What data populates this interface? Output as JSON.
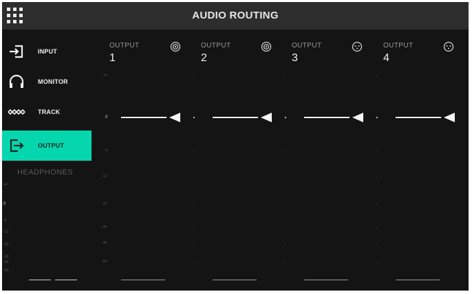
{
  "header": {
    "title": "AUDIO ROUTING",
    "menu_icon": "grid-menu-icon"
  },
  "sidebar": {
    "items": [
      {
        "label": "INPUT",
        "icon": "input-arrow-icon",
        "active": false
      },
      {
        "label": "MONITOR",
        "icon": "headphones-icon",
        "active": false
      },
      {
        "label": "TRACK",
        "icon": "track-waveform-icon",
        "active": false
      },
      {
        "label": "OUTPUT",
        "icon": "output-arrow-icon",
        "active": true
      }
    ],
    "headphones": {
      "title": "HEADPHONES",
      "scale": [
        "+6",
        "0",
        "-6",
        "-12",
        "-20",
        "-30",
        "-40",
        "-60"
      ]
    }
  },
  "outputs": {
    "scale": [
      "+6",
      "0",
      "-6",
      "-12",
      "-20",
      "-30",
      "-40",
      "-60"
    ],
    "columns": [
      {
        "label": "OUTPUT",
        "number": "1",
        "icon": "jack-connector-icon",
        "level_db": 0
      },
      {
        "label": "OUTPUT",
        "number": "2",
        "icon": "jack-connector-icon",
        "level_db": 0
      },
      {
        "label": "OUTPUT",
        "number": "3",
        "icon": "xlr-connector-icon",
        "level_db": 0
      },
      {
        "label": "OUTPUT",
        "number": "4",
        "icon": "xlr-connector-icon",
        "level_db": 0
      }
    ]
  },
  "colors": {
    "accent": "#06d6ad",
    "background": "#141414",
    "header": "#2d2d2d"
  }
}
